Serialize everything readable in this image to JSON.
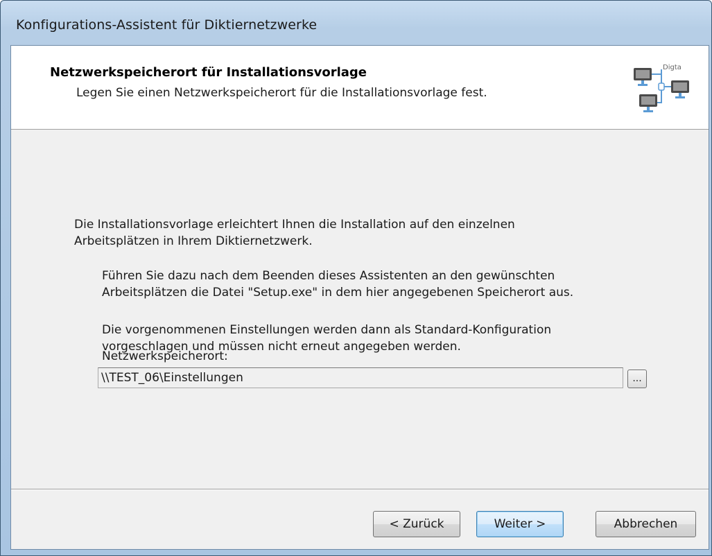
{
  "window": {
    "title": "Konfigurations-Assistent für Diktiernetzwerke"
  },
  "header": {
    "title": "Netzwerkspeicherort für Installationsvorlage",
    "subtitle": "Legen Sie einen Netzwerkspeicherort für die Installationsvorlage fest.",
    "logo_text": "Digta"
  },
  "body": {
    "intro": "Die Installationsvorlage erleichtert Ihnen die Installation auf den einzelnen\nArbeitsplätzen in Ihrem Diktiernetzwerk.",
    "instructions": "Führen Sie dazu nach dem Beenden dieses Assistenten an den gewünschten\nArbeitsplätzen die Datei \"Setup.exe\" in dem hier angegebenen Speicherort aus.",
    "note": "Die vorgenommenen Einstellungen werden dann als Standard-Konfiguration\nvorgeschlagen und müssen nicht erneut angegeben werden."
  },
  "location": {
    "label": "Netzwerkspeicherort:",
    "value": "\\\\TEST_06\\Einstellungen",
    "browse_label": "..."
  },
  "buttons": {
    "back": "< Zurück",
    "next": "Weiter >",
    "cancel": "Abbrechen"
  },
  "colors": {
    "accent": "#3c7fb1",
    "logo_monitor": "#4a4a4a",
    "logo_base": "#5b9bd5"
  }
}
